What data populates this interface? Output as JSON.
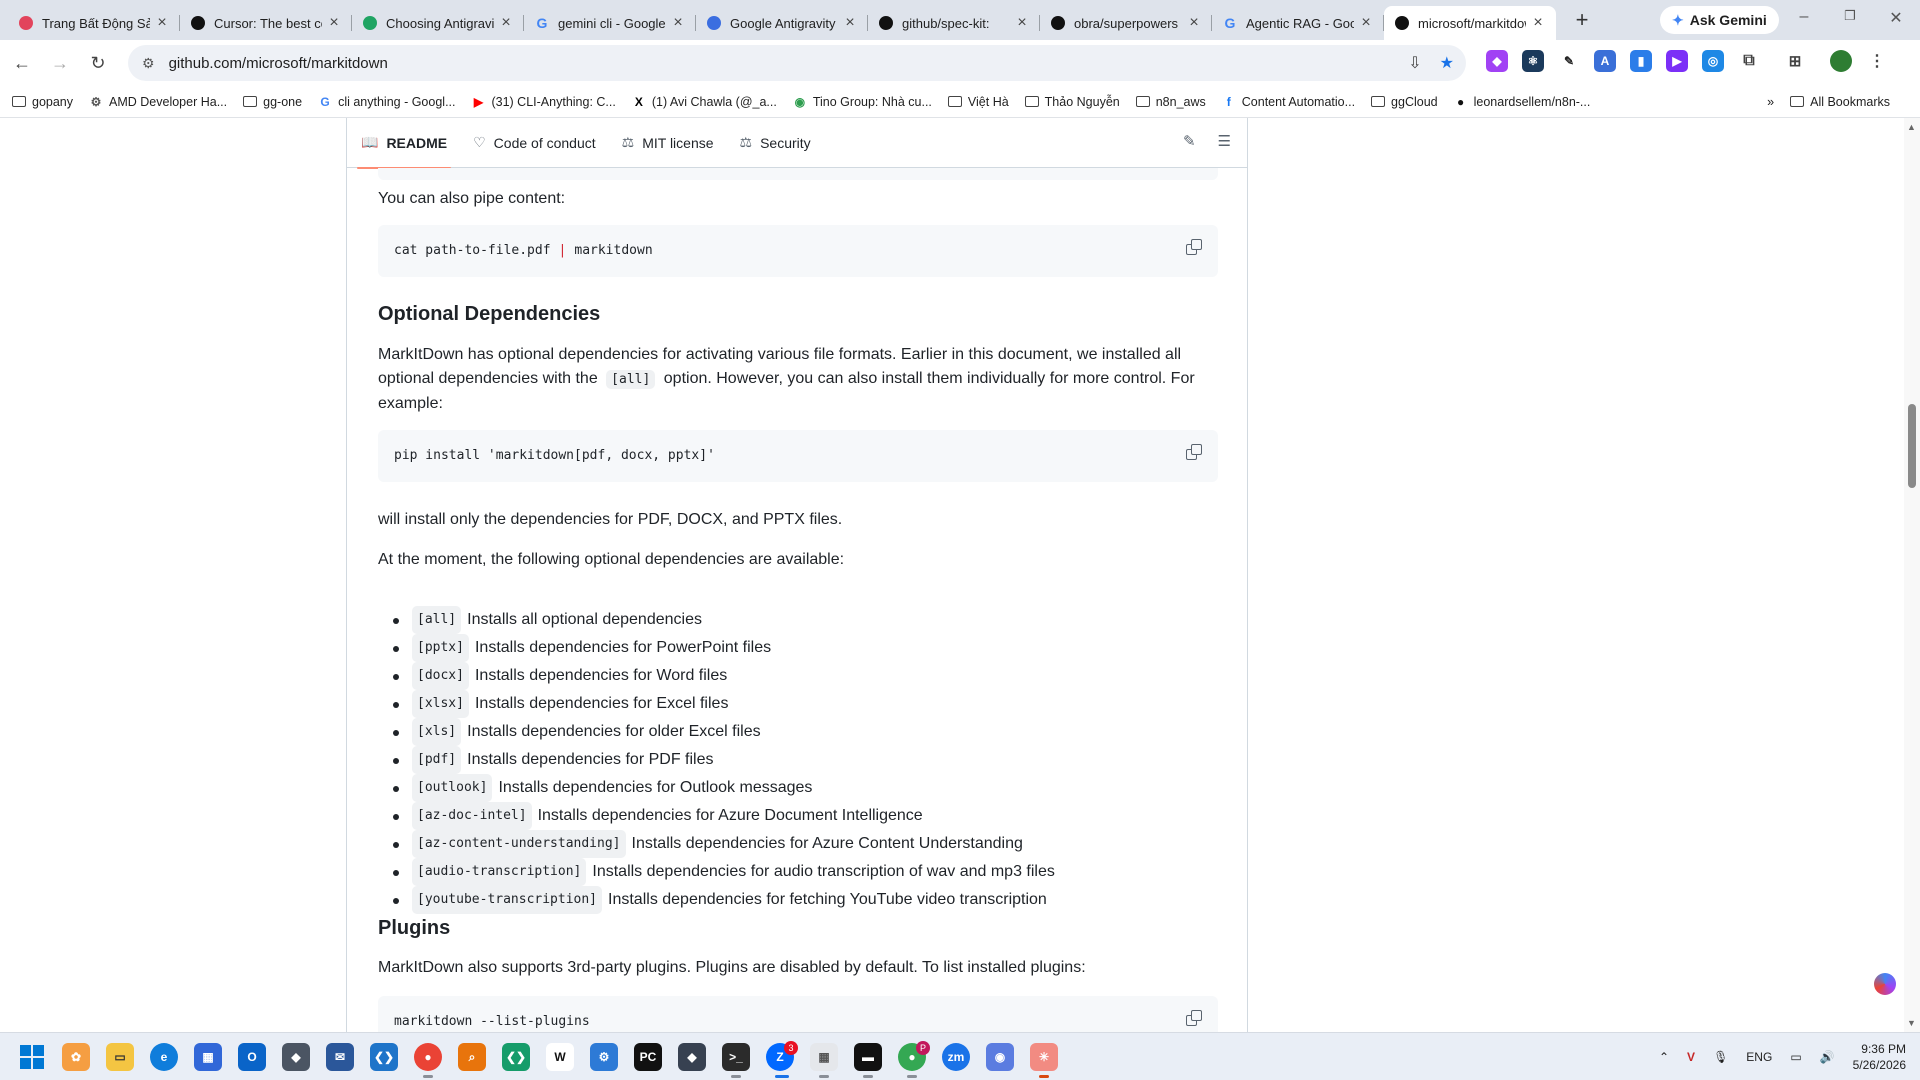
{
  "browser": {
    "tabs": [
      {
        "title": "Trang Bất Động Sản",
        "favicon": "brand-icon",
        "color": "#e2445c"
      },
      {
        "title": "Cursor: The best code",
        "favicon": "cursor-icon",
        "color": "#111111"
      },
      {
        "title": "Choosing Antigravity",
        "favicon": "google-drive-icon",
        "color": "#1fa463"
      },
      {
        "title": "gemini cli - Google",
        "favicon": "google-icon",
        "color": "#4285f4"
      },
      {
        "title": "Google Antigravity",
        "favicon": "antigravity-icon",
        "color": "#3b6ee0"
      },
      {
        "title": "github/spec-kit:",
        "favicon": "github-icon",
        "color": "#111111"
      },
      {
        "title": "obra/superpowers",
        "favicon": "github-icon",
        "color": "#111111"
      },
      {
        "title": "Agentic RAG - Google",
        "favicon": "google-icon",
        "color": "#4285f4"
      },
      {
        "title": "microsoft/markitdown",
        "favicon": "github-icon",
        "color": "#111111",
        "active": true
      }
    ],
    "ask_gemini": "Ask Gemini",
    "url": "github.com/microsoft/markitdown",
    "bookmarks": [
      {
        "label": "gopany",
        "icon": "folder-icon"
      },
      {
        "label": "AMD Developer Ha...",
        "icon": "amd-icon"
      },
      {
        "label": "gg-one",
        "icon": "folder-icon"
      },
      {
        "label": "cli anything - Googl...",
        "icon": "google-icon"
      },
      {
        "label": "(31) CLI-Anything: C...",
        "icon": "youtube-icon"
      },
      {
        "label": "(1) Avi Chawla (@_a...",
        "icon": "x-icon"
      },
      {
        "label": "Tino Group: Nhà cu...",
        "icon": "tino-icon"
      },
      {
        "label": "Việt Hà",
        "icon": "folder-icon"
      },
      {
        "label": "Thảo Nguyễn",
        "icon": "folder-icon"
      },
      {
        "label": "n8n_aws",
        "icon": "folder-icon"
      },
      {
        "label": "Content Automatio...",
        "icon": "facebook-icon"
      },
      {
        "label": "ggCloud",
        "icon": "folder-icon"
      },
      {
        "label": "leonardsellem/n8n-...",
        "icon": "github-icon"
      }
    ],
    "all_bookmarks": "All Bookmarks"
  },
  "readme_tabs": [
    {
      "label": "README",
      "icon": "book-icon",
      "active": true
    },
    {
      "label": "Code of conduct",
      "icon": "heart-shield-icon"
    },
    {
      "label": "MIT license",
      "icon": "scale-icon"
    },
    {
      "label": "Security",
      "icon": "scale-icon"
    }
  ],
  "content": {
    "pipe_intro": "You can also pipe content:",
    "pipe_cmd_left": "cat path-to-file.pdf",
    "pipe_symbol": "|",
    "pipe_cmd_right": "markitdown",
    "optional_heading": "Optional Dependencies",
    "optional_p1_a": "MarkItDown has optional dependencies for activating various file formats. Earlier in this document, we installed all optional dependencies with the",
    "optional_p1_code": "[all]",
    "optional_p1_b": "option. However, you can also install them individually for more control. For example:",
    "pip_cmd": "pip install 'markitdown[pdf, docx, pptx]'",
    "install_note": "will install only the dependencies for PDF, DOCX, and PPTX files.",
    "available_note": "At the moment, the following optional dependencies are available:",
    "deps": [
      {
        "code": "[all]",
        "text": "Installs all optional dependencies"
      },
      {
        "code": "[pptx]",
        "text": "Installs dependencies for PowerPoint files"
      },
      {
        "code": "[docx]",
        "text": "Installs dependencies for Word files"
      },
      {
        "code": "[xlsx]",
        "text": "Installs dependencies for Excel files"
      },
      {
        "code": "[xls]",
        "text": "Installs dependencies for older Excel files"
      },
      {
        "code": "[pdf]",
        "text": "Installs dependencies for PDF files"
      },
      {
        "code": "[outlook]",
        "text": "Installs dependencies for Outlook messages"
      },
      {
        "code": "[az-doc-intel]",
        "text": "Installs dependencies for Azure Document Intelligence"
      },
      {
        "code": "[az-content-understanding]",
        "text": "Installs dependencies for Azure Content Understanding"
      },
      {
        "code": "[audio-transcription]",
        "text": "Installs dependencies for audio transcription of wav and mp3 files"
      },
      {
        "code": "[youtube-transcription]",
        "text": "Installs dependencies for fetching YouTube video transcription"
      }
    ],
    "plugins_heading": "Plugins",
    "plugins_p": "MarkItDown also supports 3rd-party plugins. Plugins are disabled by default. To list installed plugins:",
    "plugins_cmd": "markitdown --list-plugins"
  },
  "taskbar": {
    "lang": "ENG",
    "time": "9:36 PM",
    "date": "5/26/2026",
    "zalo_badge": "3",
    "chrome_badge": "P"
  }
}
